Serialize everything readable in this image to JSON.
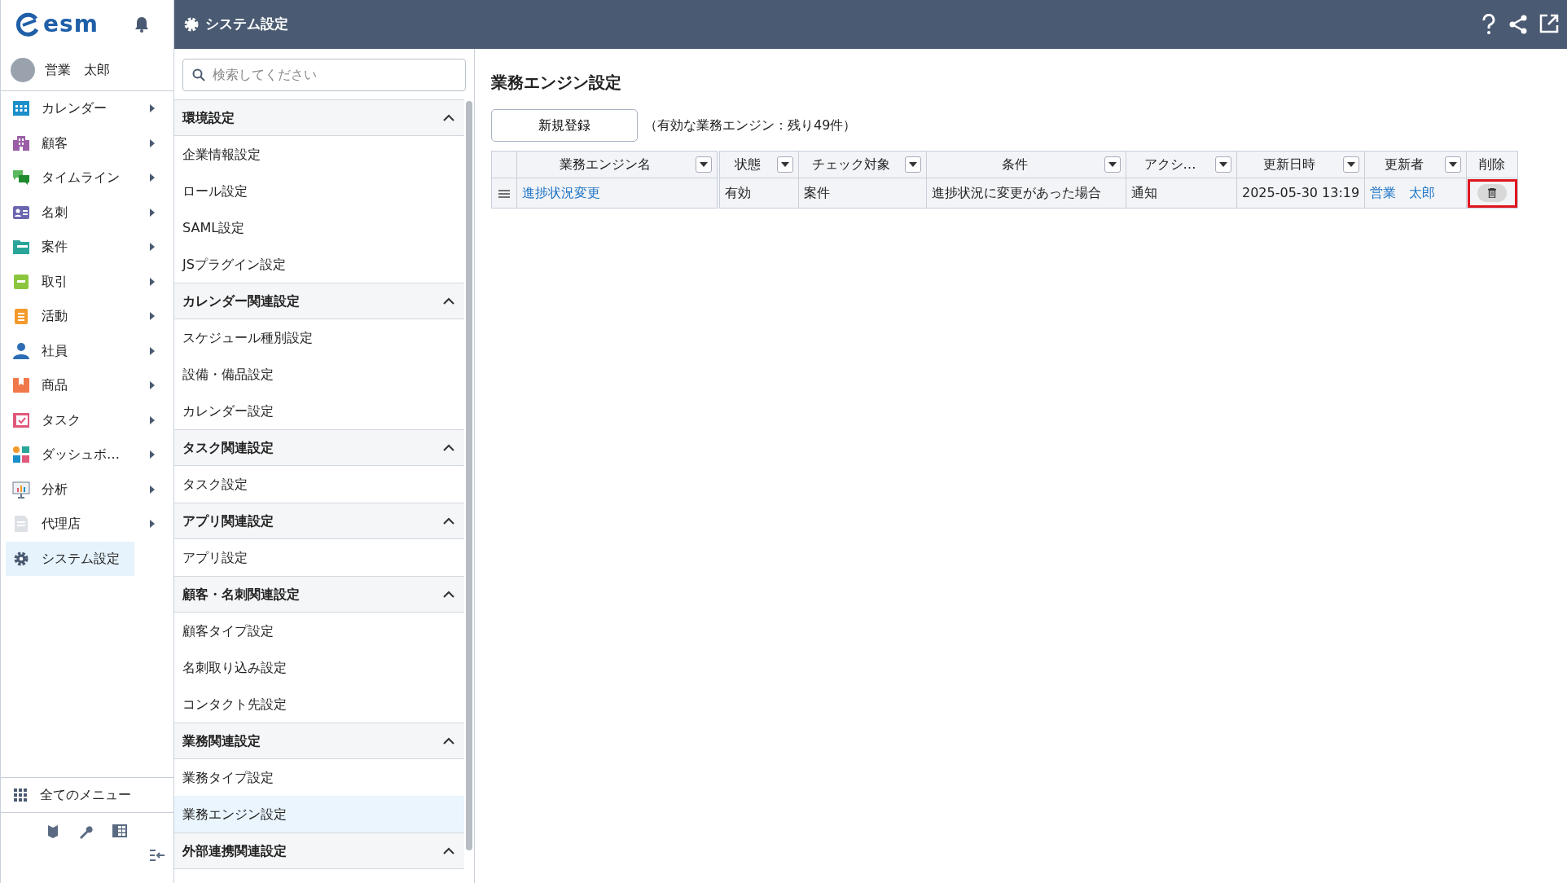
{
  "app": {
    "logo": "esm",
    "user": "営業　太郎"
  },
  "nav_items": [
    {
      "label": "カレンダー",
      "kind": "calendar",
      "submenu": true,
      "selected": false
    },
    {
      "label": "顧客",
      "kind": "building",
      "submenu": true,
      "selected": false
    },
    {
      "label": "タイムライン",
      "kind": "chat",
      "submenu": true,
      "selected": false
    },
    {
      "label": "名刺",
      "kind": "card",
      "submenu": true,
      "selected": false
    },
    {
      "label": "案件",
      "kind": "folder",
      "submenu": true,
      "selected": false
    },
    {
      "label": "取引",
      "kind": "ledger",
      "submenu": true,
      "selected": false
    },
    {
      "label": "活動",
      "kind": "clipboard",
      "submenu": true,
      "selected": false
    },
    {
      "label": "社員",
      "kind": "person",
      "submenu": true,
      "selected": false
    },
    {
      "label": "商品",
      "kind": "box",
      "submenu": true,
      "selected": false
    },
    {
      "label": "タスク",
      "kind": "task",
      "submenu": true,
      "selected": false
    },
    {
      "label": "ダッシュボ…",
      "kind": "dashboard",
      "submenu": true,
      "selected": false
    },
    {
      "label": "分析",
      "kind": "chart",
      "submenu": true,
      "selected": false
    },
    {
      "label": "代理店",
      "kind": "document",
      "submenu": true,
      "selected": false
    },
    {
      "label": "システム設定",
      "kind": "gear",
      "submenu": false,
      "selected": true
    }
  ],
  "all_menu": "全てのメニュー",
  "header": {
    "title": "システム設定"
  },
  "settings_search": {
    "placeholder": "検索してください"
  },
  "settings_sections": [
    {
      "title": "環境設定",
      "expanded": true,
      "items": [
        {
          "label": "企業情報設定",
          "selected": false
        },
        {
          "label": "ロール設定",
          "selected": false
        },
        {
          "label": "SAML設定",
          "selected": false
        },
        {
          "label": "JSプラグイン設定",
          "selected": false
        }
      ]
    },
    {
      "title": "カレンダー関連設定",
      "expanded": true,
      "items": [
        {
          "label": "スケジュール種別設定",
          "selected": false
        },
        {
          "label": "設備・備品設定",
          "selected": false
        },
        {
          "label": "カレンダー設定",
          "selected": false
        }
      ]
    },
    {
      "title": "タスク関連設定",
      "expanded": true,
      "items": [
        {
          "label": "タスク設定",
          "selected": false
        }
      ]
    },
    {
      "title": "アプリ関連設定",
      "expanded": true,
      "items": [
        {
          "label": "アプリ設定",
          "selected": false
        }
      ]
    },
    {
      "title": "顧客・名刺関連設定",
      "expanded": true,
      "items": [
        {
          "label": "顧客タイプ設定",
          "selected": false
        },
        {
          "label": "名刺取り込み設定",
          "selected": false
        },
        {
          "label": "コンタクト先設定",
          "selected": false
        }
      ]
    },
    {
      "title": "業務関連設定",
      "expanded": true,
      "items": [
        {
          "label": "業務タイプ設定",
          "selected": false
        },
        {
          "label": "業務エンジン設定",
          "selected": true
        }
      ]
    },
    {
      "title": "外部連携関連設定",
      "expanded": true
    }
  ],
  "page": {
    "title": "業務エンジン設定",
    "new_button": "新規登録",
    "quota": "（有効な業務エンジン：残り49件）"
  },
  "table": {
    "columns": [
      {
        "label": "業務エンジン名",
        "filter": true
      },
      {
        "label": "状態",
        "filter": true
      },
      {
        "label": "チェック対象",
        "filter": true
      },
      {
        "label": "条件",
        "filter": true
      },
      {
        "label": "アクシ…",
        "filter": true
      },
      {
        "label": "更新日時",
        "filter": true
      },
      {
        "label": "更新者",
        "filter": true
      },
      {
        "label": "削除",
        "filter": false
      }
    ],
    "rows": [
      {
        "cells": [
          {
            "text": "進捗状況変更",
            "kind": "link"
          },
          {
            "text": "有効",
            "kind": "text"
          },
          {
            "text": "案件",
            "kind": "text"
          },
          {
            "text": "進捗状況に変更があった場合",
            "kind": "text"
          },
          {
            "text": "通知",
            "kind": "text"
          },
          {
            "text": "2025-05-30 13:19",
            "kind": "text"
          },
          {
            "text": "営業　太郎",
            "kind": "link"
          }
        ],
        "delete_highlighted": true
      }
    ]
  }
}
